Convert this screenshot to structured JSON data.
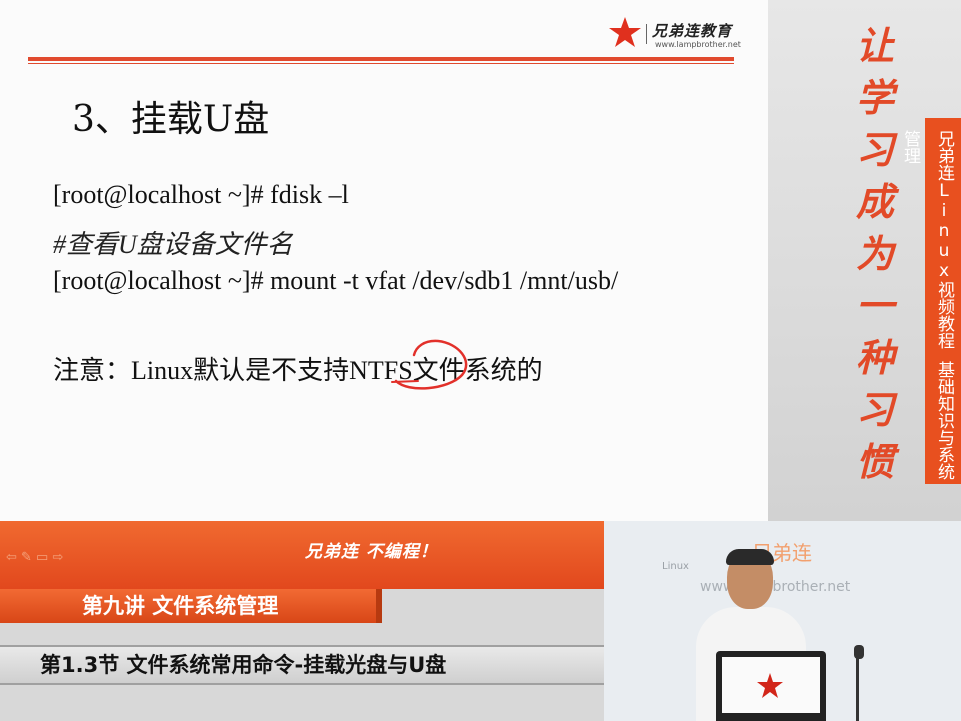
{
  "slide": {
    "brand_name": "兄弟连教育",
    "brand_url": "www.lampbrother.net",
    "heading": "3、挂载U盘",
    "lines": [
      "[root@localhost ~]# fdisk –l",
      "#查看U盘设备文件名",
      "[root@localhost ~]# mount -t vfat /dev/sdb1 /mnt/usb/",
      "注意：Linux默认是不支持NTFS文件系统的"
    ]
  },
  "banner": {
    "slogan": [
      "让",
      "学",
      "习",
      "成",
      "为",
      "一",
      "种",
      "习",
      "惯"
    ],
    "course_part1": "兄弟连Linux视频教程",
    "course_part2": "基础知识与系统管理"
  },
  "lower": {
    "nav": "⇦ ✎ ▭ ⇨",
    "motto": "兄弟连 不编程！",
    "chapter": "第九讲 文件系统管理",
    "section": "第1.3节 文件系统常用命令-挂载光盘与U盘"
  },
  "video": {
    "brand": "兄弟连",
    "linux_label": "Linux",
    "url": "www.lampbrother.net"
  },
  "colors": {
    "accent": "#e14a2e",
    "orange": "#e8501f"
  }
}
